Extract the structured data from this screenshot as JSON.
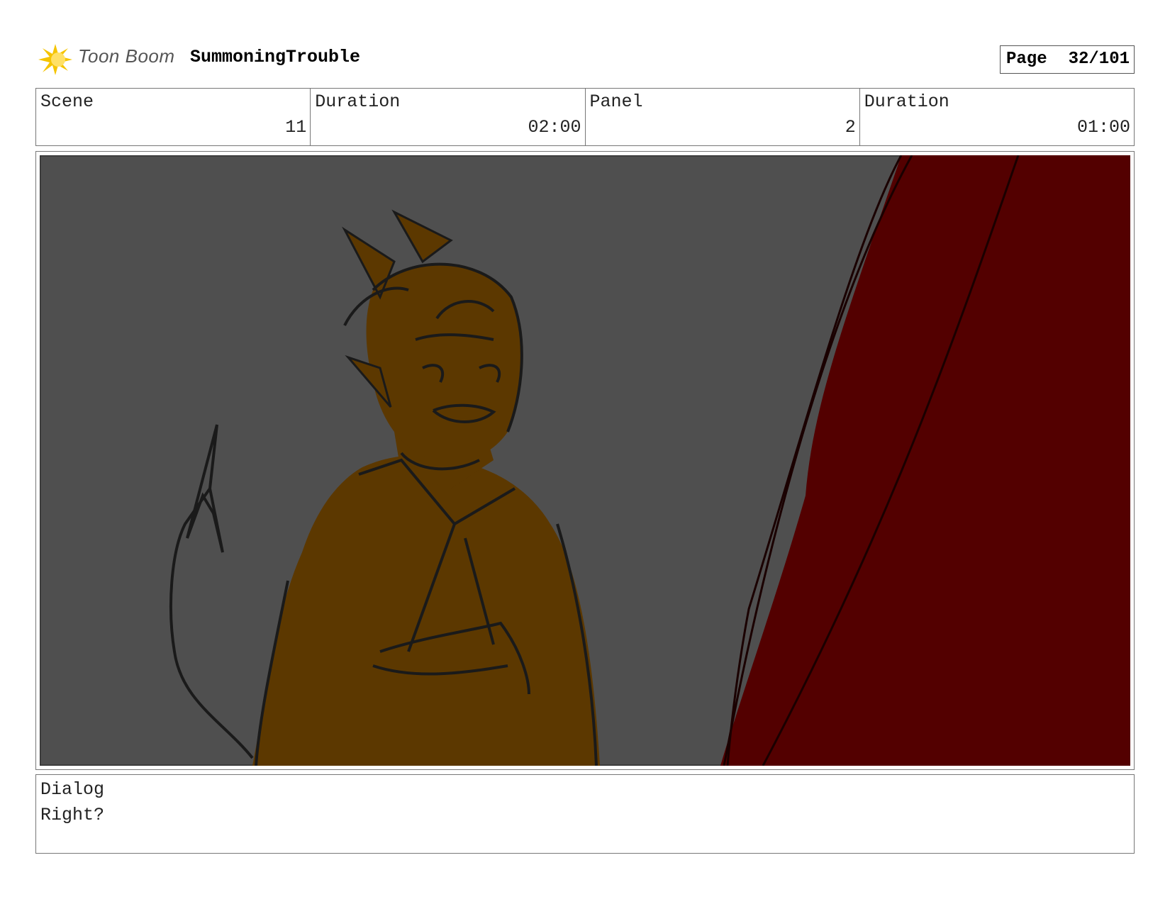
{
  "header": {
    "logo_text": "Toon Boom",
    "project_title": "SummoningTrouble",
    "page_label": "Page",
    "page_value": "32/101"
  },
  "info": {
    "scene_label": "Scene",
    "scene_value": "11",
    "scene_duration_label": "Duration",
    "scene_duration_value": "02:00",
    "panel_label": "Panel",
    "panel_value": "2",
    "panel_duration_label": "Duration",
    "panel_duration_value": "01:00"
  },
  "dialog": {
    "label": "Dialog",
    "text": "Right?"
  },
  "colors": {
    "background_wall": "#4f4f4f",
    "character_fill": "#5c3800",
    "curtain": "#530000",
    "sketch_line": "#1a1a1a",
    "logo_accent": "#f5c400"
  }
}
